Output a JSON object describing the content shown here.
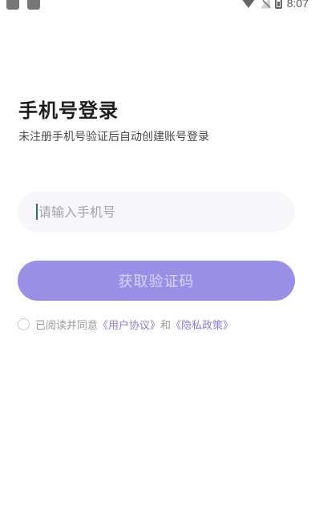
{
  "status_bar": {
    "time": "8:07",
    "icons": [
      "app-notification-icon",
      "app-notification-icon",
      "wifi-icon",
      "no-sim-signal-icon",
      "battery-icon"
    ]
  },
  "login": {
    "title": "手机号登录",
    "subtitle": "未注册手机号验证后自动创建账号登录",
    "phone_placeholder": "请输入手机号",
    "phone_value": "",
    "get_code_label": "获取验证码",
    "agreement_prefix": "已阅读并同意",
    "user_agreement_link": "《用户协议》",
    "agreement_and": "和",
    "privacy_policy_link": "《隐私政策》",
    "agreement_checked": false
  },
  "colors": {
    "accent": "#9a8fe6",
    "link": "#8a80d6",
    "input_bg": "#f7f7f9"
  }
}
